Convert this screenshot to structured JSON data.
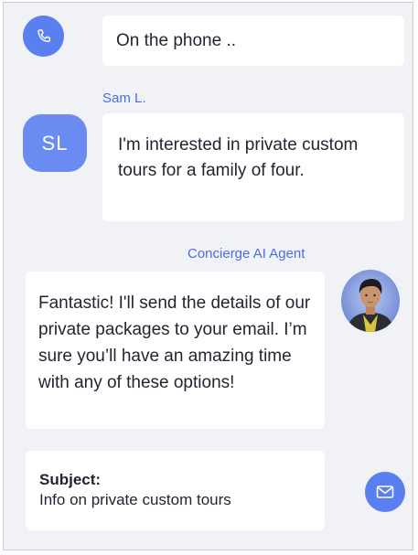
{
  "call": {
    "status_text": "On the phone ..",
    "icon": "phone-icon"
  },
  "customer": {
    "name": "Sam L.",
    "initials": "SL",
    "message": "I'm interested in private custom tours for a family of four."
  },
  "agent": {
    "name": "Concierge AI Agent",
    "message": "Fantastic! I'll send the details of our private packages to your email. I’m sure you’ll have an amazing time with any of these options!"
  },
  "email": {
    "subject_label": "Subject:",
    "subject_text": "Info on private custom tours",
    "icon": "mail-icon"
  },
  "colors": {
    "accent": "#5a7ff0",
    "background": "#f1f2f6",
    "bubble": "#ffffff",
    "sender_text": "#4a6ee6"
  }
}
